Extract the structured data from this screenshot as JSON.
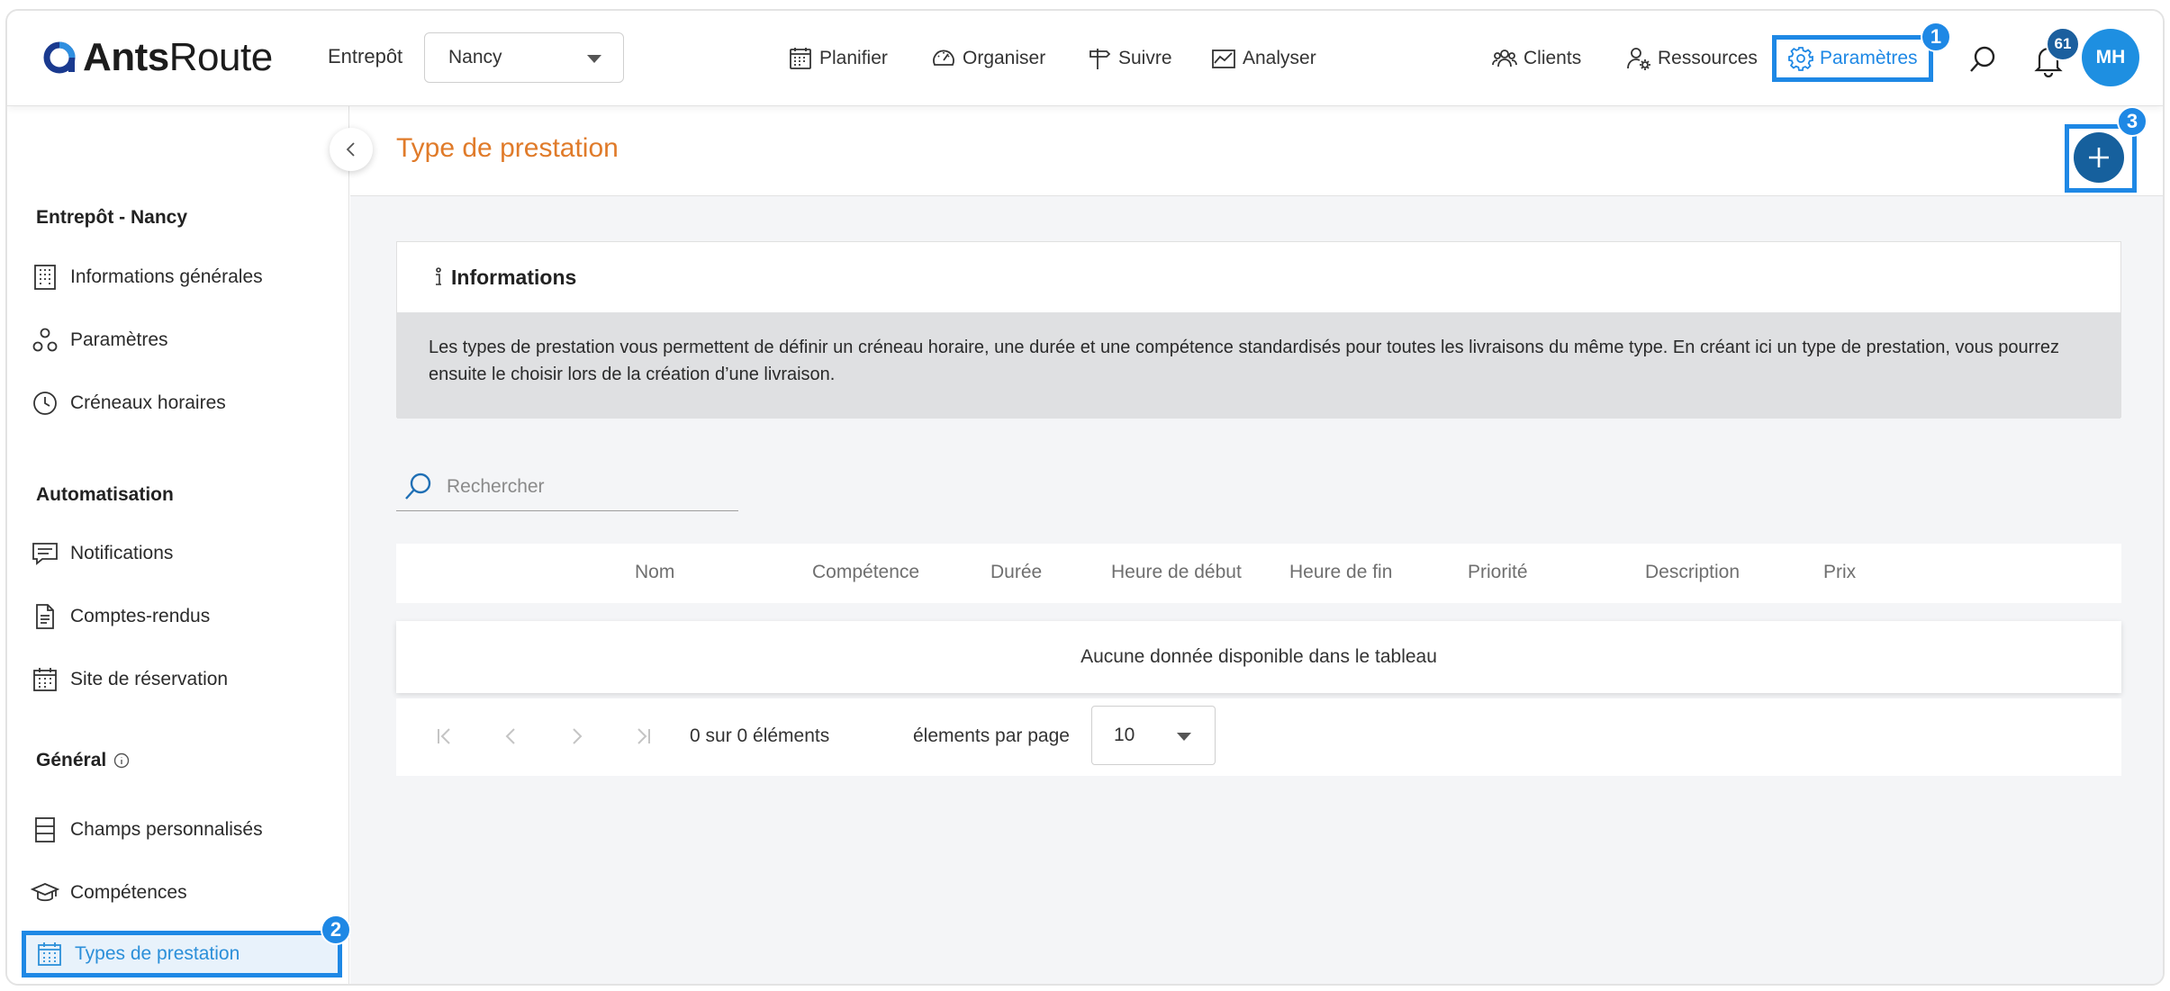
{
  "app": {
    "logo_bold": "Ants",
    "logo_light": "Route"
  },
  "topbar": {
    "warehouse_label": "Entrepôt",
    "warehouse_value": "Nancy",
    "nav": {
      "planifier": "Planifier",
      "organiser": "Organiser",
      "suivre": "Suivre",
      "analyser": "Analyser",
      "clients": "Clients",
      "ressources": "Ressources",
      "parametres": "Paramètres"
    },
    "notification_count": "61",
    "avatar_initials": "MH",
    "accent_color": "#1e88e5"
  },
  "markers": {
    "m1": "1",
    "m2": "2",
    "m3": "3"
  },
  "sidebar": {
    "section_entrepot": "Entrepôt - Nancy",
    "infos_generales": "Informations générales",
    "parametres": "Paramètres",
    "creneaux": "Créneaux horaires",
    "section_auto": "Automatisation",
    "notifications": "Notifications",
    "comptes_rendus": "Comptes-rendus",
    "site_reservation": "Site de réservation",
    "section_general": "Général",
    "champs": "Champs personnalisés",
    "competences": "Compétences",
    "types_prestation": "Types de prestation"
  },
  "main": {
    "title": "Type de prestation",
    "info_title": "Informations",
    "info_text": "Les types de prestation vous permettent de définir un créneau horaire, une durée et une compétence standardisés pour toutes les livraisons du même type. En créant ici un type de prestation, vous pourrez ensuite le choisir lors de la création d’une livraison.",
    "search_placeholder": "Rechercher",
    "columns": {
      "nom": "Nom",
      "competence": "Compétence",
      "duree": "Durée",
      "debut": "Heure de début",
      "fin": "Heure de fin",
      "priorite": "Priorité",
      "description": "Description",
      "prix": "Prix"
    },
    "empty_text": "Aucune donnée disponible dans le tableau",
    "pager_count": "0 sur 0 éléments",
    "per_page_label": "élements par page",
    "per_page_value": "10"
  }
}
